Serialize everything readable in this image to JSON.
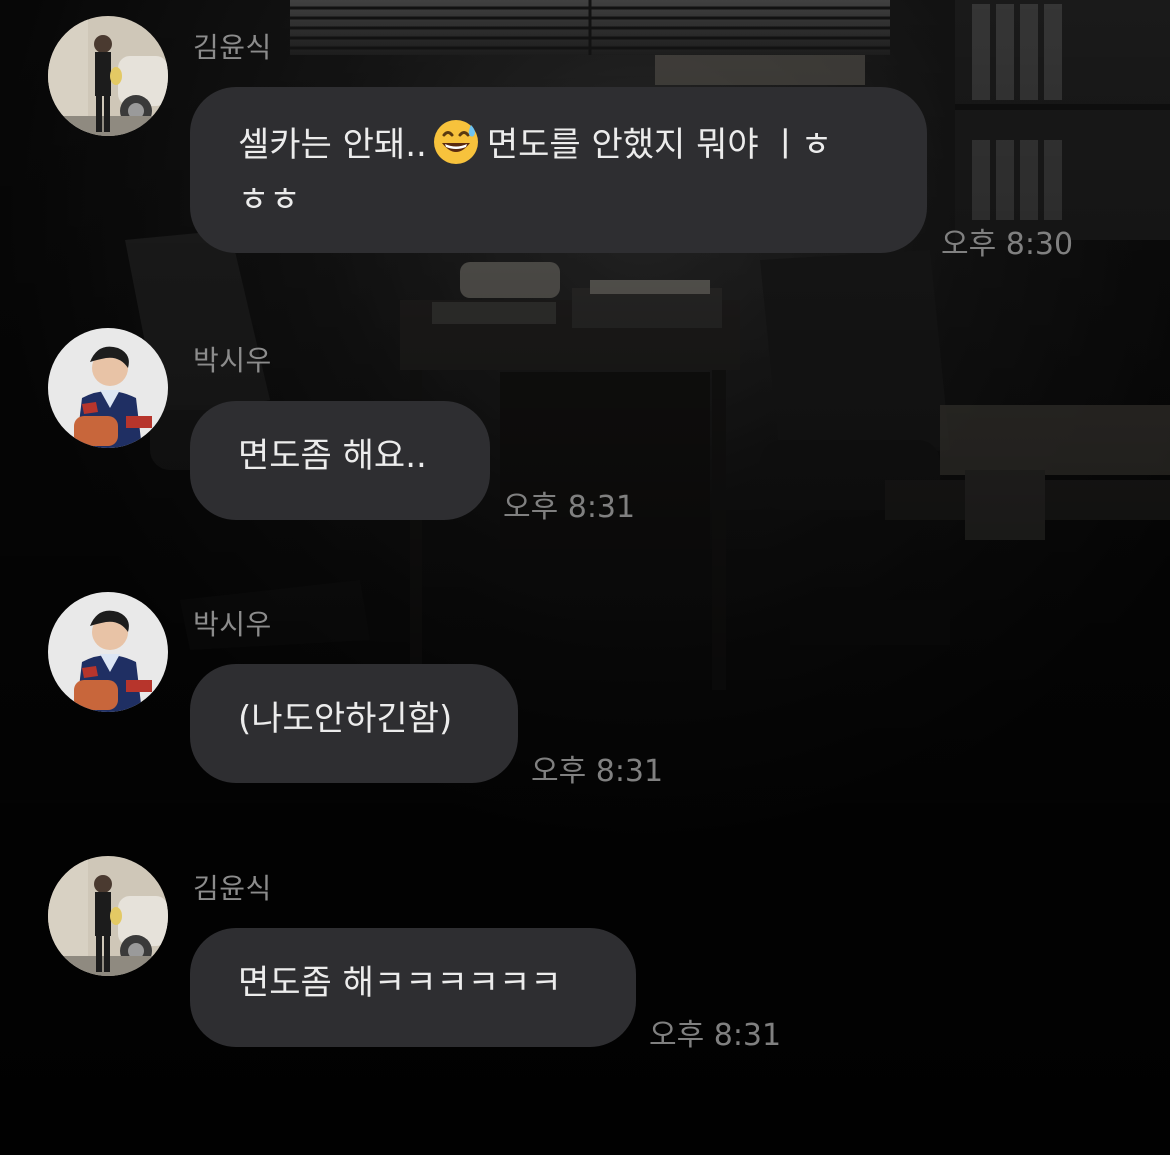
{
  "messages": [
    {
      "sender": "김윤식",
      "avatar_icon": "profile-photo-man-suit",
      "text_before_emoji": "셀카는 안돼..",
      "emoji": "grinning-sweat-emoji",
      "text_after_emoji": "면도를 안했지 뭐야 ㅣㅎ\nㅎㅎ",
      "time": "오후 8:30"
    },
    {
      "sender": "박시우",
      "avatar_icon": "profile-photo-man-sweater",
      "text": "면도좀 해요..",
      "time": "오후 8:31"
    },
    {
      "sender": "박시우",
      "avatar_icon": "profile-photo-man-sweater",
      "text": "(나도안하긴함)",
      "time": "오후 8:31"
    },
    {
      "sender": "김윤식",
      "avatar_icon": "profile-photo-man-suit",
      "text": "면도좀 해ㅋㅋㅋㅋㅋㅋ",
      "time": "오후 8:31"
    }
  ],
  "colors": {
    "bubble": "#2e2e31",
    "message_text": "#ececec",
    "sender_name": "#8c8c8c",
    "timestamp": "#808080",
    "background": "#0b0b0b"
  }
}
